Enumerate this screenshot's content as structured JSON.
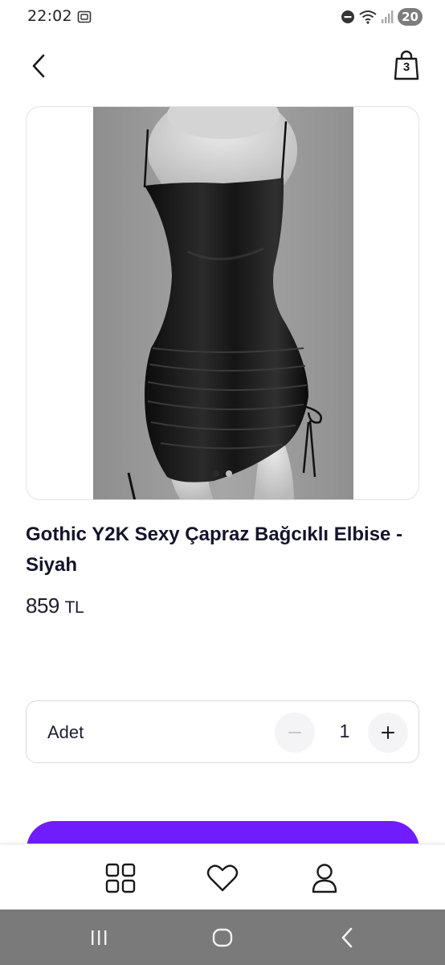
{
  "status_bar": {
    "time": "22:02",
    "battery": "20",
    "icons": [
      "screen-recorder-icon",
      "do-not-disturb-icon",
      "wifi-icon",
      "signal-icon"
    ]
  },
  "header": {
    "back_icon": "chevron-left-icon",
    "cart_icon": "shopping-bag-icon",
    "cart_count": "3"
  },
  "product": {
    "image_alt": "black satin ruched mini dress on mannequin",
    "carousel": {
      "total": 2,
      "active": 1
    },
    "title": "Gothic Y2K Sexy Çapraz Bağcıklı Elbise - Siyah",
    "price_value": "859",
    "price_currency": "TL"
  },
  "quantity": {
    "label": "Adet",
    "value": "1",
    "minus_icon": "minus-icon",
    "plus_icon": "plus-icon"
  },
  "add_button": {
    "label": "",
    "color": "#6f1dfc"
  },
  "bottom_nav": {
    "items": [
      {
        "icon": "categories-grid-icon"
      },
      {
        "icon": "heart-icon"
      },
      {
        "icon": "user-icon"
      }
    ]
  },
  "android_nav": {
    "items": [
      "recents-icon",
      "home-icon",
      "back-icon"
    ]
  },
  "colors": {
    "accent": "#6f1dfc",
    "text": "#14142b",
    "border": "#d9d9de",
    "system_nav": "#7a7a7a"
  }
}
